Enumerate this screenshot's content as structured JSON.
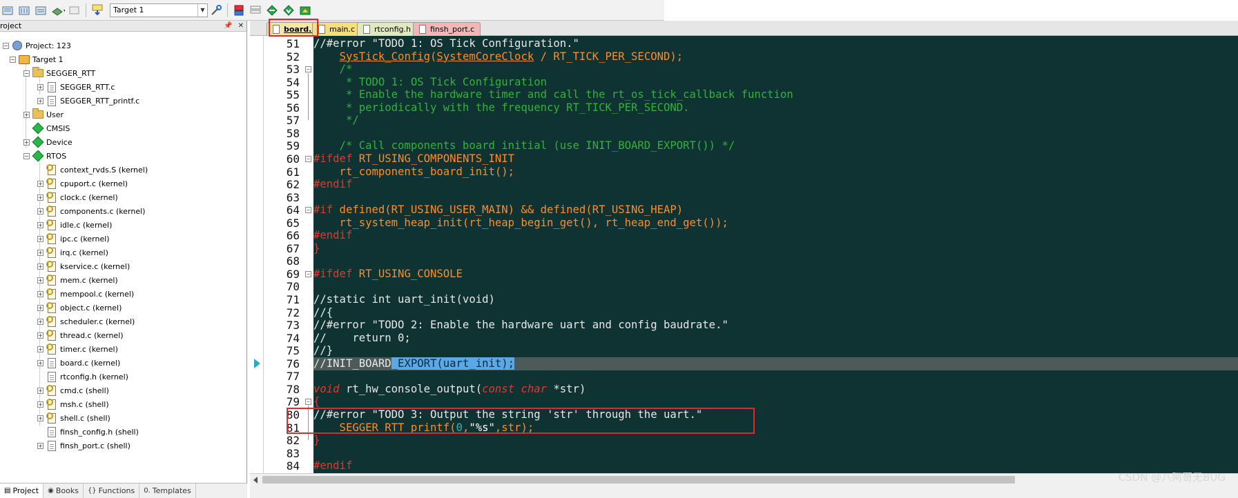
{
  "toolbar": {
    "target_value": "Target 1",
    "buttons": [
      "build-icon",
      "rebuild-icon",
      "batch-build-icon",
      "translate-icon",
      "stop-build-icon",
      "download-icon",
      "options-icon",
      "manage-icon",
      "insert-icon",
      "green-diamond-icon",
      "pack-installer-icon"
    ]
  },
  "project_pane": {
    "header": "roject",
    "project_label": "Project: 123",
    "target_label": "Target 1",
    "groups": [
      {
        "label": "SEGGER_RTT",
        "files": [
          "SEGGER_RTT.c",
          "SEGGER_RTT_printf.c"
        ]
      },
      {
        "label": "User"
      },
      {
        "label": "CMSIS"
      },
      {
        "label": "Device"
      },
      {
        "label": "RTOS",
        "files": [
          "context_rvds.S (kernel)",
          "cpuport.c (kernel)",
          "clock.c (kernel)",
          "components.c (kernel)",
          "idle.c (kernel)",
          "ipc.c (kernel)",
          "irq.c (kernel)",
          "kservice.c (kernel)",
          "mem.c (kernel)",
          "mempool.c (kernel)",
          "object.c (kernel)",
          "scheduler.c (kernel)",
          "thread.c (kernel)",
          "timer.c (kernel)",
          "board.c (kernel)",
          "rtconfig.h (kernel)",
          "cmd.c (shell)",
          "msh.c (shell)",
          "shell.c (shell)",
          "finsh_config.h (shell)",
          "finsh_port.c (shell)"
        ]
      }
    ],
    "tabs": [
      "Project",
      "Books",
      "Functions",
      "Templates"
    ]
  },
  "editor": {
    "tabs": [
      "board.c",
      "main.c",
      "rtconfig.h",
      "finsh_port.c"
    ],
    "active_tab": "board.c",
    "lines": [
      {
        "n": "51",
        "t": "//#error \"TODO 1: OS Tick Configuration.\""
      },
      {
        "n": "52",
        "t": "    SysTick_Config(SystemCoreClock / RT_TICK_PER_SECOND);"
      },
      {
        "n": "53",
        "t": "    /*"
      },
      {
        "n": "54",
        "t": "     * TODO 1: OS Tick Configuration"
      },
      {
        "n": "55",
        "t": "     * Enable the hardware timer and call the rt_os_tick_callback function"
      },
      {
        "n": "56",
        "t": "     * periodically with the frequency RT_TICK_PER_SECOND."
      },
      {
        "n": "57",
        "t": "     */"
      },
      {
        "n": "58",
        "t": ""
      },
      {
        "n": "59",
        "t": "    /* Call components board initial (use INIT_BOARD_EXPORT()) */"
      },
      {
        "n": "60",
        "t": "#ifdef RT_USING_COMPONENTS_INIT"
      },
      {
        "n": "61",
        "t": "    rt_components_board_init();"
      },
      {
        "n": "62",
        "t": "#endif"
      },
      {
        "n": "63",
        "t": ""
      },
      {
        "n": "64",
        "t": "#if defined(RT_USING_USER_MAIN) && defined(RT_USING_HEAP)"
      },
      {
        "n": "65",
        "t": "    rt_system_heap_init(rt_heap_begin_get(), rt_heap_end_get());"
      },
      {
        "n": "66",
        "t": "#endif"
      },
      {
        "n": "67",
        "t": "}"
      },
      {
        "n": "68",
        "t": ""
      },
      {
        "n": "69",
        "t": "#ifdef RT_USING_CONSOLE"
      },
      {
        "n": "70",
        "t": ""
      },
      {
        "n": "71",
        "t": "//static int uart_init(void)"
      },
      {
        "n": "72",
        "t": "//{"
      },
      {
        "n": "73",
        "t": "//#error \"TODO 2: Enable the hardware uart and config baudrate.\""
      },
      {
        "n": "74",
        "t": "//    return 0;"
      },
      {
        "n": "75",
        "t": "//}"
      },
      {
        "n": "76",
        "t": "//INIT_BOARD_EXPORT(uart_init);"
      },
      {
        "n": "77",
        "t": ""
      },
      {
        "n": "78",
        "t": "void rt_hw_console_output(const char *str)"
      },
      {
        "n": "79",
        "t": "{"
      },
      {
        "n": "80",
        "t": "//#error \"TODO 3: Output the string 'str' through the uart.\""
      },
      {
        "n": "81",
        "t": "    SEGGER_RTT_printf(0,\"%s\",str);"
      },
      {
        "n": "82",
        "t": "}"
      },
      {
        "n": "83",
        "t": ""
      },
      {
        "n": "84",
        "t": "#endif"
      }
    ]
  },
  "watermark": "CSDN @八阿哥无BUG",
  "colors": {
    "editor_bg": "#0f3232",
    "comment": "#33b23a",
    "preprocessor": "#e03a2e",
    "identifier": "#ff8c28",
    "annotation_red": "#e5262b"
  }
}
